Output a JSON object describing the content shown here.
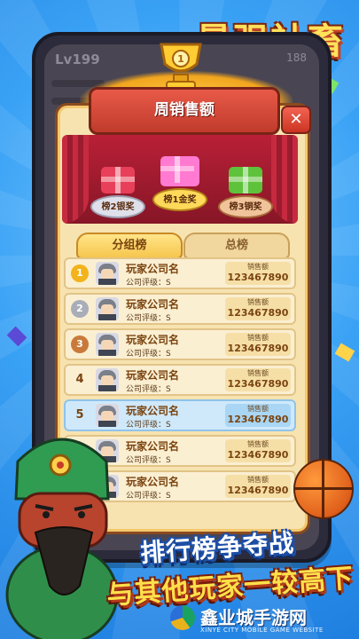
{
  "banner": {
    "title": "最强社畜"
  },
  "background_game": {
    "level": "Lv199",
    "number": "188"
  },
  "modal": {
    "title": "周销售额",
    "close_label": "✕",
    "prizes": [
      {
        "label": "榜2银奖",
        "color": "#e8e8ef"
      },
      {
        "label": "榜1金奖",
        "color": "#ffd95a"
      },
      {
        "label": "榜3铜奖",
        "color": "#f1c39a"
      }
    ],
    "tabs": [
      {
        "label": "分组榜",
        "active": true
      },
      {
        "label": "总榜",
        "active": false
      }
    ],
    "rows": [
      {
        "rank": "1",
        "medal": "gold",
        "name": "玩家公司名",
        "grade": "公司评级：S",
        "sales_label": "销售额",
        "sales": "123467890",
        "me": false
      },
      {
        "rank": "2",
        "medal": "silver",
        "name": "玩家公司名",
        "grade": "公司评级：S",
        "sales_label": "销售额",
        "sales": "123467890",
        "me": false
      },
      {
        "rank": "3",
        "medal": "bronze",
        "name": "玩家公司名",
        "grade": "公司评级：S",
        "sales_label": "销售额",
        "sales": "123467890",
        "me": false
      },
      {
        "rank": "4",
        "medal": "none",
        "name": "玩家公司名",
        "grade": "公司评级：S",
        "sales_label": "销售额",
        "sales": "123467890",
        "me": false
      },
      {
        "rank": "5",
        "medal": "none",
        "name": "玩家公司名",
        "grade": "公司评级：S",
        "sales_label": "销售额",
        "sales": "123467890",
        "me": true
      },
      {
        "rank": "",
        "medal": "none",
        "name": "玩家公司名",
        "grade": "公司评级：S",
        "sales_label": "销售额",
        "sales": "123467890",
        "me": false
      },
      {
        "rank": "",
        "medal": "none",
        "name": "玩家公司名",
        "grade": "公司评级：S",
        "sales_label": "销售额",
        "sales": "123467890",
        "me": false
      }
    ]
  },
  "slogan": {
    "line1": "排行榜争夺战",
    "line2": "与其他玩家一较高下"
  },
  "watermark": {
    "main": "鑫业城手游网",
    "sub": "XINYE CITY MOBILE GAME WEBSITE"
  },
  "colors": {
    "gold": "#f2b31b",
    "silver": "#a9adb8",
    "bronze": "#c97a3a"
  }
}
